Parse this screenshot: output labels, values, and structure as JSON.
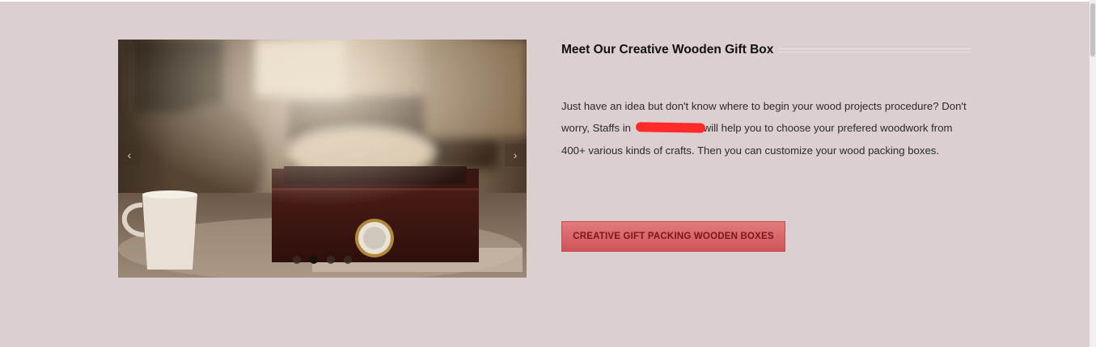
{
  "section": {
    "title": "Meet Our Creative Wooden Gift Box",
    "paragraph_part1": "Just have an idea but don't know where to begin your wood projects procedure? Don't worry, Staffs in ",
    "paragraph_part2": "will help you to choose your prefered woodwork from 400+ various kinds of crafts. Then you can customize your wood packing boxes.",
    "cta_label": "CREATIVE GIFT PACKING WOODEN BOXES"
  },
  "slider": {
    "prev_icon": "‹",
    "next_icon": "›",
    "dot_count": 4,
    "active_index": 1
  },
  "colors": {
    "background": "#dbcfcf",
    "cta": "#d9686a",
    "redaction": "#ff2a2a"
  }
}
